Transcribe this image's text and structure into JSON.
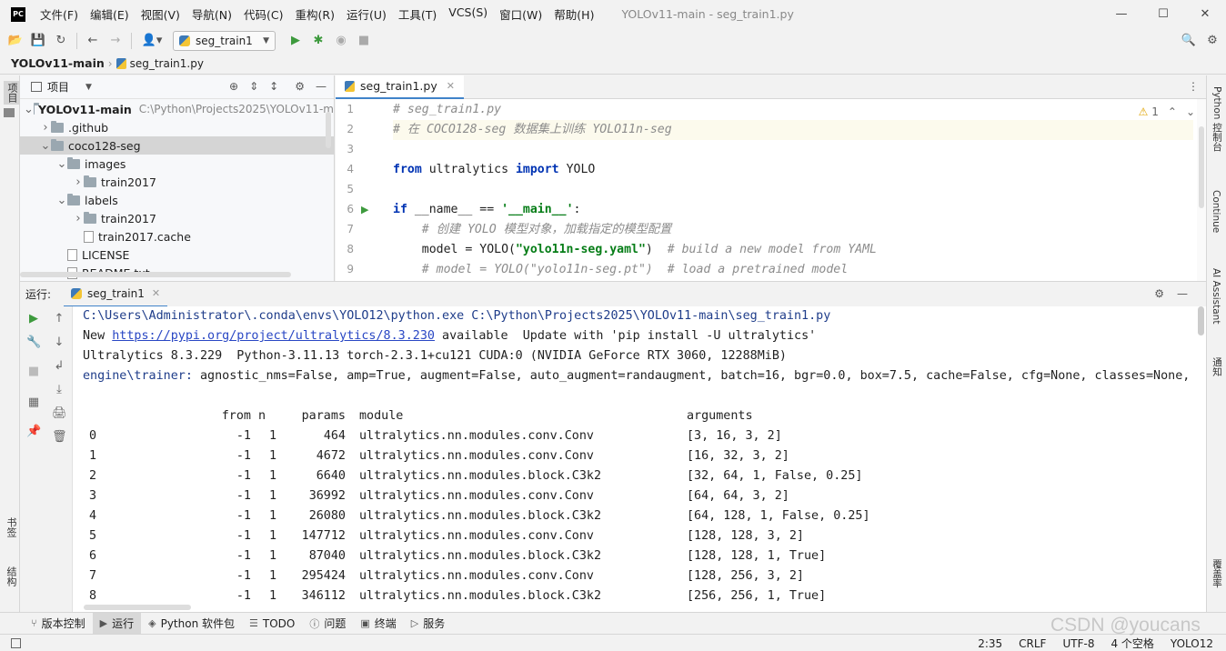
{
  "app": {
    "logo": "PC",
    "menus": [
      "文件(F)",
      "编辑(E)",
      "视图(V)",
      "导航(N)",
      "代码(C)",
      "重构(R)",
      "运行(U)",
      "工具(T)",
      "VCS(S)",
      "窗口(W)",
      "帮助(H)"
    ],
    "window_title": "YOLOv11-main - seg_train1.py"
  },
  "toolbar": {
    "run_config": "seg_train1"
  },
  "breadcrumb": {
    "project": "YOLOv11-main",
    "file": "seg_train1.py"
  },
  "left_stripe": {
    "project_tab": "项目",
    "bookmarks_tab": "书签",
    "structure_tab": "结构"
  },
  "right_stripe": {
    "python_console": "Python 控制台",
    "continue": "Continue",
    "ai_assistant": "AI Assistant",
    "notifications": "通知",
    "coverage": "覆盖率"
  },
  "project_panel": {
    "title": "项目",
    "tree": [
      {
        "label": "YOLOv11-main",
        "hint": "C:\\Python\\Projects2025\\YOLOv11-m",
        "depth": 0,
        "type": "folder",
        "expanded": true
      },
      {
        "label": ".github",
        "depth": 1,
        "type": "folder",
        "expanded": false
      },
      {
        "label": "coco128-seg",
        "depth": 1,
        "type": "folder",
        "expanded": true,
        "selected": true
      },
      {
        "label": "images",
        "depth": 2,
        "type": "folder",
        "expanded": true
      },
      {
        "label": "train2017",
        "depth": 3,
        "type": "folder",
        "expanded": false
      },
      {
        "label": "labels",
        "depth": 2,
        "type": "folder",
        "expanded": true
      },
      {
        "label": "train2017",
        "depth": 3,
        "type": "folder",
        "expanded": false
      },
      {
        "label": "train2017.cache",
        "depth": 3,
        "type": "file"
      },
      {
        "label": "LICENSE",
        "depth": 2,
        "type": "file"
      },
      {
        "label": "README.txt",
        "depth": 2,
        "type": "file"
      }
    ]
  },
  "editor": {
    "tab": "seg_train1.py",
    "warnings": "1",
    "lines": [
      {
        "n": "1",
        "segments": [
          {
            "t": "# seg_train1.py",
            "c": "cmt"
          }
        ]
      },
      {
        "n": "2",
        "segments": [
          {
            "t": "# 在 COCO128-seg 数据集上训练 YOLO11n-seg",
            "c": "cmt"
          }
        ]
      },
      {
        "n": "3",
        "segments": []
      },
      {
        "n": "4",
        "segments": [
          {
            "t": "from",
            "c": "kw"
          },
          {
            "t": " ultralytics ",
            "c": ""
          },
          {
            "t": "import",
            "c": "kw"
          },
          {
            "t": " YOLO",
            "c": ""
          }
        ]
      },
      {
        "n": "5",
        "segments": []
      },
      {
        "n": "6",
        "segments": [
          {
            "t": "if",
            "c": "kw"
          },
          {
            "t": " __name__ == ",
            "c": ""
          },
          {
            "t": "'__main__'",
            "c": "str"
          },
          {
            "t": ":",
            "c": ""
          }
        ]
      },
      {
        "n": "7",
        "segments": [
          {
            "t": "    # 创建 YOLO 模型对象，加载指定的模型配置",
            "c": "cmt"
          }
        ]
      },
      {
        "n": "8",
        "segments": [
          {
            "t": "    model = YOLO(",
            "c": ""
          },
          {
            "t": "\"yolo11n-seg.yaml\"",
            "c": "str"
          },
          {
            "t": ")  ",
            "c": ""
          },
          {
            "t": "# build a new model from YAML",
            "c": "cmt"
          }
        ]
      },
      {
        "n": "9",
        "segments": [
          {
            "t": "    # model = YOLO(\"yolo11n-seg.pt\")  # load a pretrained model",
            "c": "cmt"
          }
        ]
      }
    ]
  },
  "run": {
    "label": "运行:",
    "tab": "seg_train1",
    "cmd_line": "C:\\Users\\Administrator\\.conda\\envs\\YOLO12\\python.exe C:\\Python\\Projects2025\\YOLOv11-main\\seg_train1.py",
    "update_prefix": "New ",
    "update_link": "https://pypi.org/project/ultralytics/8.3.230",
    "update_suffix": " available  Update with 'pip install -U ultralytics'",
    "env_line": "Ultralytics 8.3.229  Python-3.11.13 torch-2.3.1+cu121 CUDA:0 (NVIDIA GeForce RTX 3060, 12288MiB)",
    "trainer_key": "engine\\trainer:",
    "trainer_args": " agnostic_nms=False, amp=True, augment=False, auto_augment=randaugment, batch=16, bgr=0.0, box=7.5, cache=False, cfg=None, classes=None, clo",
    "table_headers": {
      "from": "from",
      "n": "n",
      "params": "params",
      "module": "module",
      "arguments": "arguments"
    },
    "table_rows": [
      {
        "idx": "0",
        "from": "-1",
        "n": "1",
        "params": "464",
        "module": "ultralytics.nn.modules.conv.Conv",
        "args": "[3, 16, 3, 2]"
      },
      {
        "idx": "1",
        "from": "-1",
        "n": "1",
        "params": "4672",
        "module": "ultralytics.nn.modules.conv.Conv",
        "args": "[16, 32, 3, 2]"
      },
      {
        "idx": "2",
        "from": "-1",
        "n": "1",
        "params": "6640",
        "module": "ultralytics.nn.modules.block.C3k2",
        "args": "[32, 64, 1, False, 0.25]"
      },
      {
        "idx": "3",
        "from": "-1",
        "n": "1",
        "params": "36992",
        "module": "ultralytics.nn.modules.conv.Conv",
        "args": "[64, 64, 3, 2]"
      },
      {
        "idx": "4",
        "from": "-1",
        "n": "1",
        "params": "26080",
        "module": "ultralytics.nn.modules.block.C3k2",
        "args": "[64, 128, 1, False, 0.25]"
      },
      {
        "idx": "5",
        "from": "-1",
        "n": "1",
        "params": "147712",
        "module": "ultralytics.nn.modules.conv.Conv",
        "args": "[128, 128, 3, 2]"
      },
      {
        "idx": "6",
        "from": "-1",
        "n": "1",
        "params": "87040",
        "module": "ultralytics.nn.modules.block.C3k2",
        "args": "[128, 128, 1, True]"
      },
      {
        "idx": "7",
        "from": "-1",
        "n": "1",
        "params": "295424",
        "module": "ultralytics.nn.modules.conv.Conv",
        "args": "[128, 256, 3, 2]"
      },
      {
        "idx": "8",
        "from": "-1",
        "n": "1",
        "params": "346112",
        "module": "ultralytics.nn.modules.block.C3k2",
        "args": "[256, 256, 1, True]"
      }
    ]
  },
  "tool_windows": [
    "版本控制",
    "运行",
    "Python 软件包",
    "TODO",
    "问题",
    "终端",
    "服务"
  ],
  "status": {
    "position": "2:35",
    "line_sep": "CRLF",
    "encoding": "UTF-8",
    "indent": "4 个空格",
    "interpreter": "YOLO12"
  },
  "watermark": "CSDN @youcans",
  "colors": {
    "accent": "#4083c9",
    "keyword": "#0033b3",
    "string": "#067d17",
    "comment": "#8c8c8c",
    "run_green": "#3d9a3d"
  }
}
